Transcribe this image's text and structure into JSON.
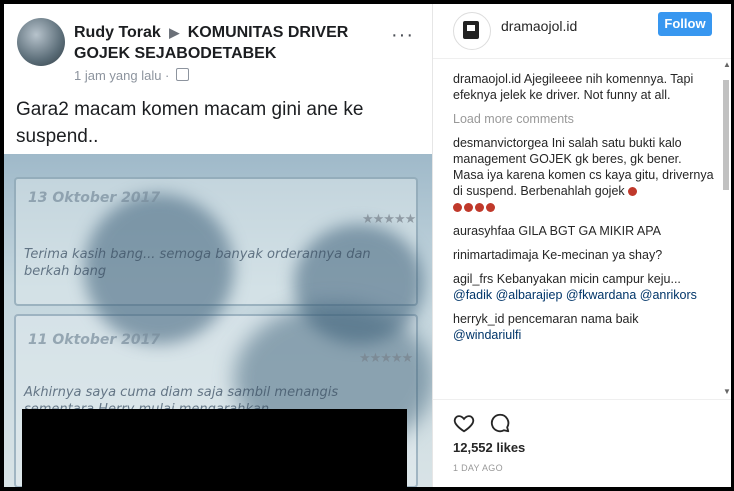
{
  "fb_post": {
    "poster_name": "Rudy Torak",
    "arrow": "▶",
    "group_name": "KOMUNITAS DRIVER GOJEK SEJABODETABEK",
    "time": "1 jam yang lalu ·",
    "body": "Gara2 macam komen macam gini ane ke suspend..",
    "more_icon": "more-dots-icon",
    "photo_texts": {
      "date1": "13 Oktober 2017",
      "review1": "Terima kasih bang... semoga banyak orderannya dan berkah bang",
      "date2": "11 Oktober 2017",
      "review2": "Akhirnya saya cuma diam saja sambil menangis sementara Herry mulai mengarahkan"
    }
  },
  "ig": {
    "username": "dramaojol.id",
    "follow_label": "Follow",
    "load_more": "Load more comments",
    "comments": [
      {
        "user": "dramaojol.id",
        "text": "Ajegileeee nih komennya. Tapi efeknya jelek ke driver. Not funny at all."
      },
      {
        "user": "desmanvictorgea",
        "text": "Ini salah satu bukti kalo management GOJEK gk beres, gk bener. Masa iya karena komen cs kaya gitu, drivernya di suspend. Berbenahlah gojek"
      },
      {
        "user": "aurasyhfaa",
        "text": "GILA BGT GA MIKIR APA"
      },
      {
        "user": "rinimartadimaja",
        "text": "Ke-mecinan ya shay?"
      },
      {
        "user": "agil_frs",
        "text": "Kebanyakan micin campur keju..."
      },
      {
        "user": "herryk_id",
        "text": "pencemaran nama baik"
      }
    ],
    "mentions_agil": "@fadik @albarajiep @fkwardana @anrikors",
    "mentions_herry": "@windariulfi",
    "likes": "12,552 likes",
    "time_ago": "1 DAY AGO"
  }
}
